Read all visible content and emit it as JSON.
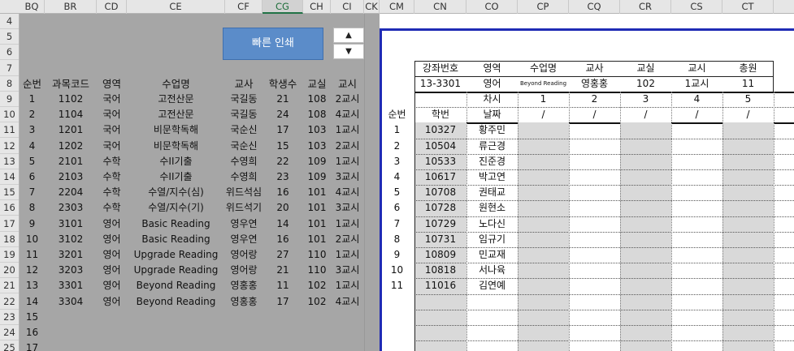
{
  "columns": [
    "BQ",
    "BR",
    "CD",
    "CE",
    "CF",
    "CG",
    "CH",
    "CI",
    "CK",
    "CM",
    "CN",
    "CO",
    "CP",
    "CQ",
    "CR",
    "CS",
    "CT"
  ],
  "selected_column": "CG",
  "rows": [
    "4",
    "5",
    "6",
    "7",
    "8",
    "9",
    "10",
    "11",
    "12",
    "13",
    "14",
    "15",
    "16",
    "17",
    "18",
    "19",
    "20",
    "21",
    "22",
    "23",
    "24",
    "25"
  ],
  "last_row_partial": "17",
  "left": {
    "quick_print_label": "빠른 인쇄",
    "spin_up": "▲",
    "spin_down": "▼",
    "headers": [
      "순번",
      "과목코드",
      "영역",
      "수업명",
      "교사",
      "학생수",
      "교실",
      "교시"
    ],
    "courses": [
      [
        "1",
        "1102",
        "국어",
        "고전산문",
        "국길동",
        "21",
        "108",
        "2교시"
      ],
      [
        "2",
        "1104",
        "국어",
        "고전산문",
        "국길동",
        "24",
        "108",
        "4교시"
      ],
      [
        "3",
        "1201",
        "국어",
        "비문학독해",
        "국순신",
        "17",
        "103",
        "1교시"
      ],
      [
        "4",
        "1202",
        "국어",
        "비문학독해",
        "국순신",
        "15",
        "103",
        "2교시"
      ],
      [
        "5",
        "2101",
        "수학",
        "수II기출",
        "수영희",
        "22",
        "109",
        "1교시"
      ],
      [
        "6",
        "2103",
        "수학",
        "수II기출",
        "수영희",
        "23",
        "109",
        "3교시"
      ],
      [
        "7",
        "2204",
        "수학",
        "수열/지수(심)",
        "위드석심",
        "16",
        "101",
        "4교시"
      ],
      [
        "8",
        "2303",
        "수학",
        "수열/지수(기)",
        "위드석기",
        "20",
        "101",
        "3교시"
      ],
      [
        "9",
        "3101",
        "영어",
        "Basic Reading",
        "영우연",
        "14",
        "101",
        "1교시"
      ],
      [
        "10",
        "3102",
        "영어",
        "Basic Reading",
        "영우연",
        "16",
        "101",
        "2교시"
      ],
      [
        "11",
        "3201",
        "영어",
        "Upgrade Reading",
        "영어랑",
        "27",
        "110",
        "1교시"
      ],
      [
        "12",
        "3203",
        "영어",
        "Upgrade Reading",
        "영어랑",
        "21",
        "110",
        "3교시"
      ],
      [
        "13",
        "3301",
        "영어",
        "Beyond Reading",
        "영홍홍",
        "11",
        "102",
        "1교시"
      ],
      [
        "14",
        "3304",
        "영어",
        "Beyond Reading",
        "영홍홍",
        "17",
        "102",
        "4교시"
      ],
      [
        "15",
        "",
        "",
        "",
        "",
        "",
        "",
        ""
      ],
      [
        "16",
        "",
        "",
        "",
        "",
        "",
        "",
        ""
      ],
      [
        "17",
        "",
        "",
        "",
        "",
        "",
        "",
        ""
      ]
    ]
  },
  "right": {
    "info_headers": [
      "강좌번호",
      "영역",
      "수업명",
      "교사",
      "교실",
      "교시",
      "총원"
    ],
    "info_values": [
      "13-3301",
      "영어",
      "Beyond Reading",
      "영홍홍",
      "102",
      "1교시",
      "11"
    ],
    "session_label": "차시",
    "sessions": [
      "1",
      "2",
      "3",
      "4",
      "5"
    ],
    "date_label": "날짜",
    "date_values": [
      "/",
      "/",
      "/",
      "/",
      "/"
    ],
    "col_seq": "순번",
    "col_id": "학번",
    "students": [
      {
        "seq": "1",
        "id": "10327",
        "name": "황주민"
      },
      {
        "seq": "2",
        "id": "10504",
        "name": "류근경"
      },
      {
        "seq": "3",
        "id": "10533",
        "name": "진준경"
      },
      {
        "seq": "4",
        "id": "10617",
        "name": "박고연"
      },
      {
        "seq": "5",
        "id": "10708",
        "name": "권태교"
      },
      {
        "seq": "6",
        "id": "10728",
        "name": "원현소"
      },
      {
        "seq": "7",
        "id": "10729",
        "name": "노다신"
      },
      {
        "seq": "8",
        "id": "10731",
        "name": "임규기"
      },
      {
        "seq": "9",
        "id": "10809",
        "name": "민교재"
      },
      {
        "seq": "10",
        "id": "10818",
        "name": "서나육"
      },
      {
        "seq": "11",
        "id": "11016",
        "name": "김연예"
      }
    ]
  }
}
